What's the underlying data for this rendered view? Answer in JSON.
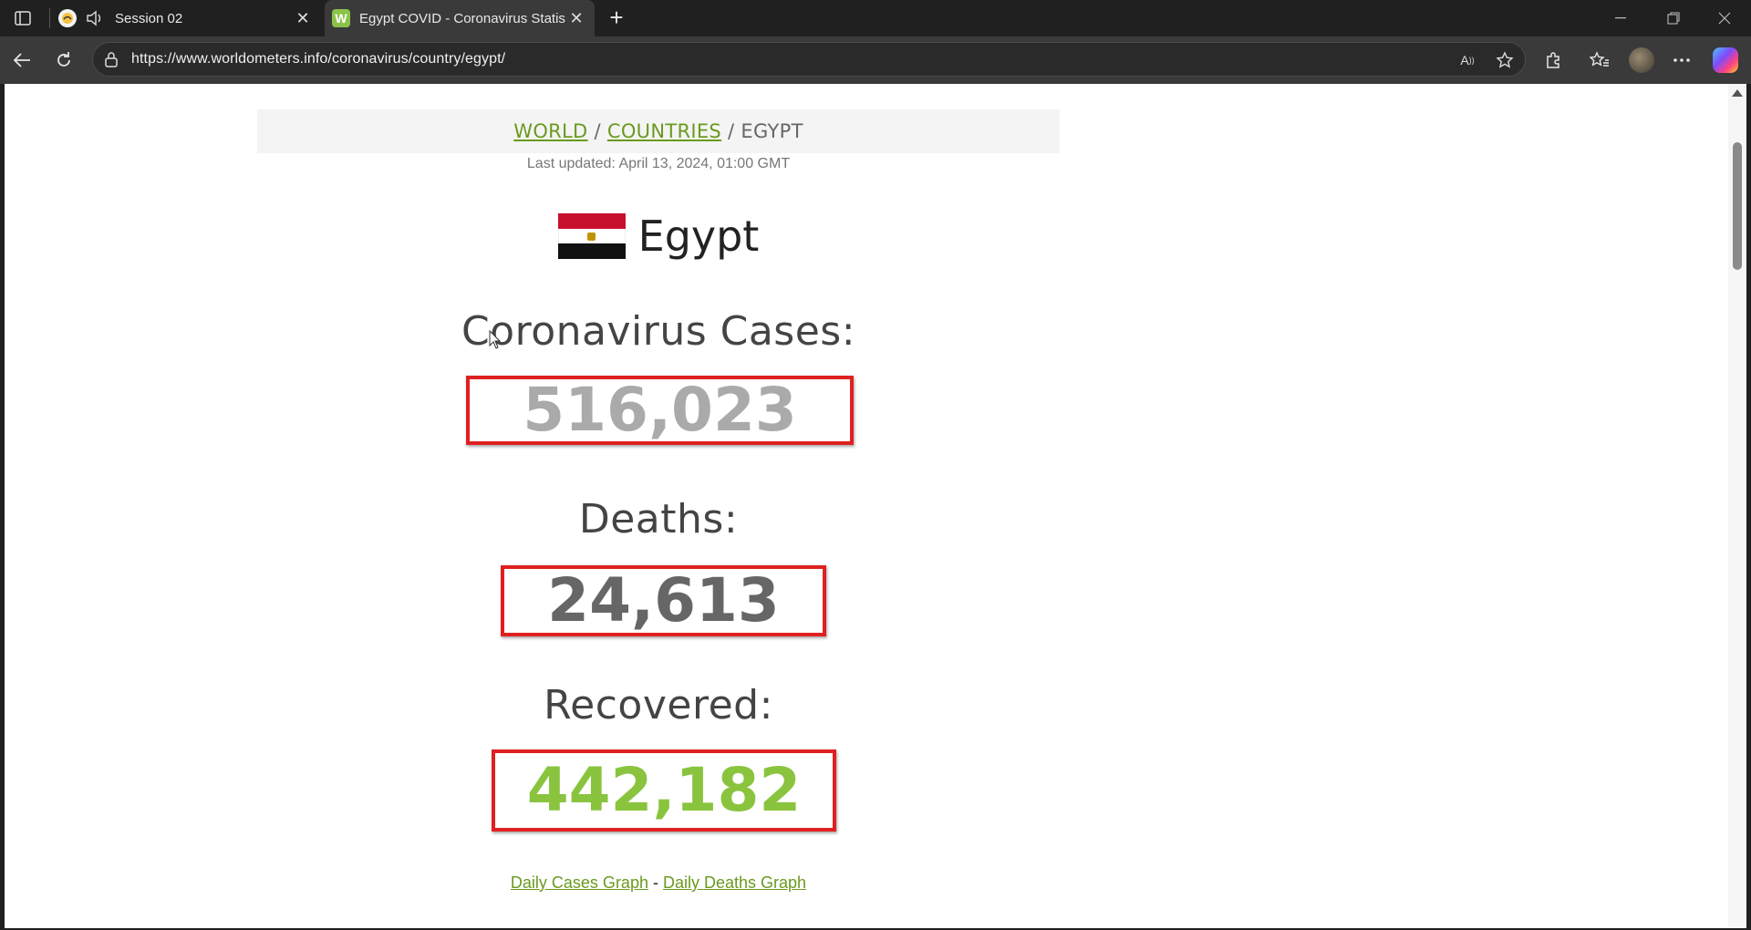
{
  "browser": {
    "tabs": [
      {
        "title": "Session 02",
        "favicon": "session-favicon",
        "audio": true,
        "active": false
      },
      {
        "title": "Egypt COVID - Coronavirus Statistics",
        "favicon": "worldometers-favicon",
        "favicon_letter": "W",
        "active": true
      }
    ],
    "url": "https://www.worldometers.info/coronavirus/country/egypt/"
  },
  "page": {
    "breadcrumb": {
      "world": "WORLD",
      "sep1": "/",
      "countries": "COUNTRIES",
      "sep2": "/",
      "current": "EGYPT"
    },
    "last_updated": "Last updated: April 13, 2024, 01:00 GMT",
    "country": "Egypt",
    "stats": [
      {
        "label": "Coronavirus Cases:",
        "value": "516,023",
        "color": "#aaaaaa"
      },
      {
        "label": "Deaths:",
        "value": "24,613",
        "color": "#666666"
      },
      {
        "label": "Recovered:",
        "value": "442,182",
        "color": "#8ac43f"
      }
    ],
    "links": {
      "daily_cases": "Daily Cases Graph",
      "separator": "-",
      "daily_deaths": "Daily Deaths Graph"
    }
  },
  "colors": {
    "highlight_box": "#e02020",
    "link": "#6a9a1f"
  }
}
